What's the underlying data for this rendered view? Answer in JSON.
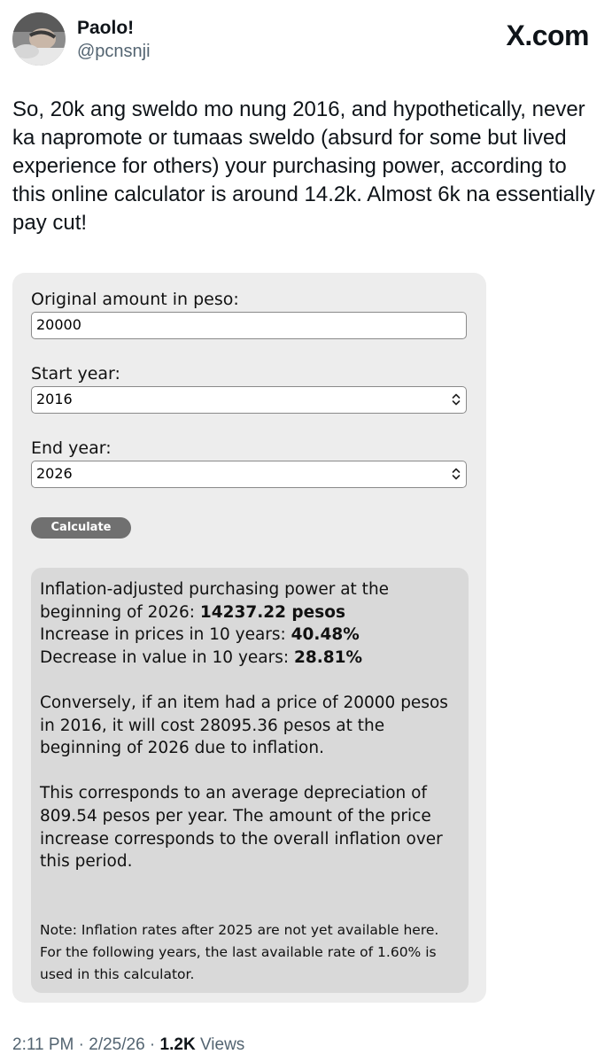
{
  "tweet": {
    "author_name": "Paolo!",
    "handle": "@pcnsnji",
    "brand": "X.com",
    "text": "So, 20k ang sweldo mo nung 2016, and hypothetically, never ka napromote or tumaas sweldo (absurd for some but lived experience for others) your purchasing power, according to this online calculator is around 14.2k. Almost 6k na essentially pay cut!"
  },
  "calculator": {
    "amount_label": "Original amount in peso:",
    "amount_value": "20000",
    "start_label": "Start year:",
    "start_value": "2016",
    "end_label": "End year:",
    "end_value": "2026",
    "calculate_label": "Calculate"
  },
  "result": {
    "line1a": "Inflation-adjusted purchasing power at the beginning of 2026: ",
    "line1b": "14237.22 pesos",
    "line2a": "Increase in prices in 10 years: ",
    "line2b": "40.48%",
    "line3a": "Decrease in value in 10 years: ",
    "line3b": "28.81%",
    "para2": "Conversely, if an item had a price of 20000 pesos in 2016, it will cost 28095.36 pesos at the beginning of 2026 due to inflation.",
    "para3": "This corresponds to an average depreciation of 809.54 pesos per year. The amount of the price increase corresponds to the overall inflation over this period.",
    "note": "Note: Inflation rates after 2025 are not yet available here. For the following years, the last available rate of 1.60% is used in this calculator."
  },
  "footer": {
    "time": "2:11 PM",
    "separator1": " · ",
    "date": "2/25/26",
    "separator2": " · ",
    "views_count": "1.2K",
    "views_label": " Views"
  },
  "icons": {
    "avatar": "avatar-photo",
    "select_arrow": "updown-chevron-icon"
  }
}
